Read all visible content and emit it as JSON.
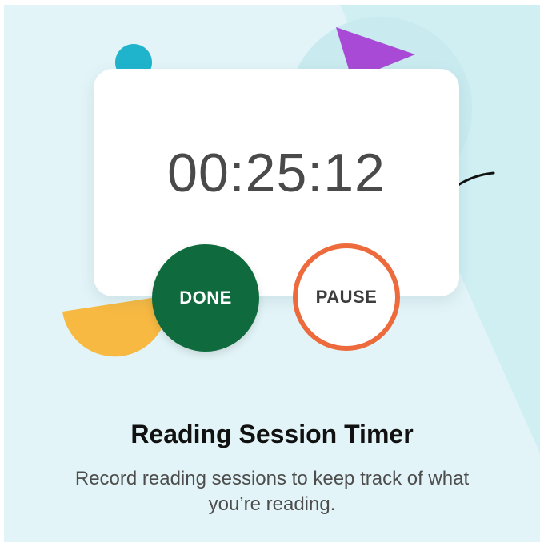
{
  "timer": {
    "display": "00:25:12"
  },
  "buttons": {
    "done_label": "DONE",
    "pause_label": "PAUSE"
  },
  "heading": {
    "title": "Reading Session Timer",
    "subtitle": "Record reading sessions to keep track of what you’re reading."
  },
  "colors": {
    "background": "#e2f4f7",
    "done_button": "#0f6b3e",
    "pause_border": "#ec6a3c",
    "accent_purple": "#a84ad6",
    "accent_yellow": "#f7b942",
    "accent_teal": "#1fb4cc"
  }
}
